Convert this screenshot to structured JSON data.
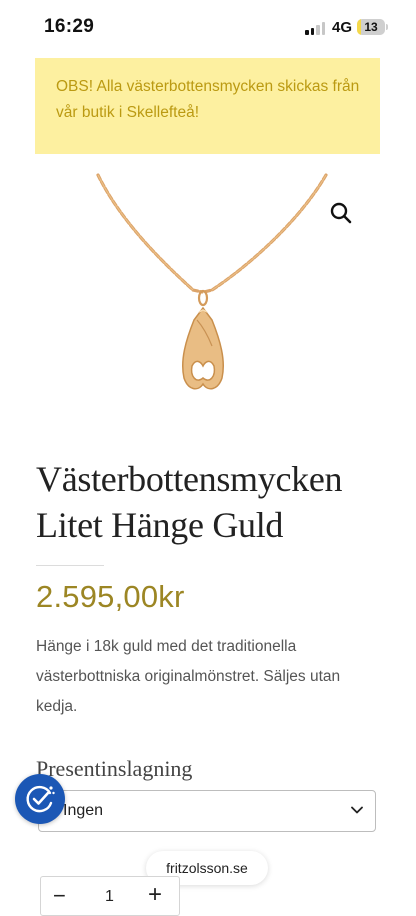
{
  "status_bar": {
    "time": "16:29",
    "network": "4G",
    "battery_level": "13"
  },
  "notice": {
    "text": "OBS! Alla västerbottensmycken skickas från vår butik i Skellefteå!"
  },
  "product": {
    "image_icon": "necklace-pendant-image",
    "zoom_icon": "search-icon",
    "title": "Västerbottensmycken Litet Hänge Guld",
    "price": "2.595,00kr",
    "description": "Hänge i 18k guld med det traditionella västerbottniska originalmönstret. Säljes utan kedja."
  },
  "options": {
    "gift_wrap_label": "Presentinslagning",
    "gift_wrap_value": "Ingen"
  },
  "quantity": {
    "minus": "−",
    "value": "1",
    "plus": "+"
  },
  "browser": {
    "domain": "fritzolsson.se"
  },
  "accessibility": {
    "icon": "accessibility-icon"
  },
  "colors": {
    "notice_bg": "#fdf0a0",
    "notice_text": "#bb9a12",
    "price": "#9c8624",
    "accessibility_button": "#1b57b5"
  }
}
